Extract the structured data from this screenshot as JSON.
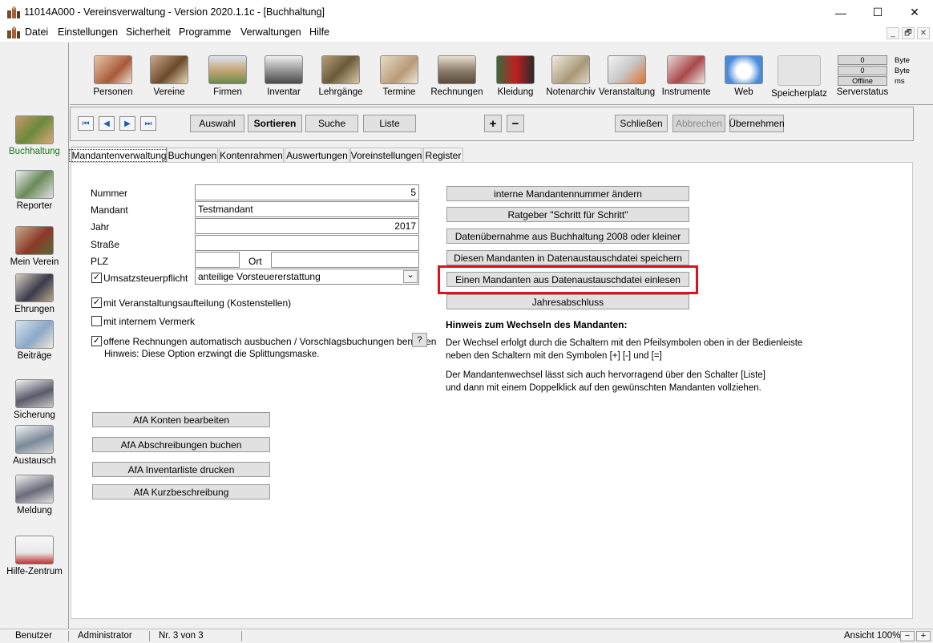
{
  "window": {
    "title": "11014A000 - Vereinsverwaltung - Version 2020.1.1c - [Buchhaltung]",
    "controls": {
      "minimize": "—",
      "maximize": "☐",
      "close": "✕"
    }
  },
  "menu": {
    "items": [
      "Datei",
      "Einstellungen",
      "Sicherheit",
      "Programme",
      "Verwaltungen",
      "Hilfe"
    ],
    "mdi": {
      "minimize": "_",
      "restore": "🗗",
      "close": "✕"
    }
  },
  "toolbar": {
    "logo": "cm",
    "tools": [
      "Personen",
      "Vereine",
      "Firmen",
      "Inventar",
      "Lehrgänge",
      "Termine",
      "Rechnungen",
      "Kleidung",
      "Notenarchiv",
      "Veranstaltung",
      "Instrumente",
      "Web",
      "Speicherplatz",
      "Serverstatus"
    ],
    "status": {
      "values": [
        "0",
        "0",
        "Offline"
      ],
      "units": [
        "Byte",
        "Byte",
        "ms"
      ]
    }
  },
  "sidebar": {
    "items": [
      "Buchhaltung",
      "Reporter",
      "Mein Verein",
      "Ehrungen",
      "Beiträge",
      "Sicherung",
      "Austausch",
      "Meldung",
      "Hilfe-Zentrum"
    ],
    "active_color": "#1a7a1a"
  },
  "navbar": {
    "arrows": {
      "first": "⏮",
      "prev": "◀",
      "next": "▶",
      "last": "⏭"
    },
    "buttons": {
      "auswahl": "Auswahl",
      "sortieren": "Sortieren",
      "suche": "Suche",
      "liste": "Liste",
      "plus": "+",
      "minus": "−",
      "schliessen": "Schließen",
      "abbrechen": "Abbrechen",
      "uebernehmen": "Übernehmen"
    }
  },
  "tabs": [
    "Mandantenverwaltung",
    "Buchungen",
    "Kontenrahmen",
    "Auswertungen",
    "Voreinstellungen",
    "Register"
  ],
  "form": {
    "nummer_label": "Nummer",
    "nummer_value": "5",
    "mandant_label": "Mandant",
    "mandant_value": "Testmandant",
    "jahr_label": "Jahr",
    "jahr_value": "2017",
    "strasse_label": "Straße",
    "strasse_value": "",
    "plz_label": "PLZ",
    "plz_value": "",
    "ort_label": "Ort",
    "ort_value": "",
    "ust_label": "Umsatzsteuerpflicht",
    "ust_checked": "✓",
    "ust_select": "anteilige Vorsteuererstattung",
    "select_arrow": "⌄",
    "veranstaltung_label": "mit Veranstaltungsaufteilung (Kostenstellen)",
    "veranstaltung_checked": "✓",
    "vermerk_label": "mit internem Vermerk",
    "vermerk_checked": "",
    "rechnungen_label": "offene Rechnungen automatisch ausbuchen / Vorschlagsbuchungen benutzen",
    "rechnungen_checked": "✓",
    "help_button": "?",
    "hinweis_text": "Hinweis: Diese Option erzwingt die Splittungsmaske."
  },
  "afa_buttons": [
    "AfA Konten bearbeiten",
    "AfA Abschreibungen buchen",
    "AfA Inventarliste drucken",
    "AfA Kurzbeschreibung"
  ],
  "right_buttons": [
    "interne Mandantennummer ändern",
    "Ratgeber \"Schritt für Schritt\"",
    "Datenübernahme aus Buchhaltung 2008 oder kleiner",
    "Diesen Mandanten in Datenaustauschdatei speichern",
    "Einen Mandanten aus Datenaustauschdatei  einlesen",
    "Jahresabschluss"
  ],
  "hint": {
    "title": "Hinweis zum Wechseln des Mandanten:",
    "p1_line1": "Der Wechsel erfolgt durch die Schaltern mit den Pfeilsymbolen oben in der Bedienleiste",
    "p1_line2": "neben den Schaltern mit den Symbolen [+] [-] und [=]",
    "p2_line1": "Der Mandantenwechsel lässt sich auch hervorragend über den Schalter [Liste]",
    "p2_line2": "und dann mit einem Doppelklick auf den gewünschten Mandanten vollziehen."
  },
  "statusbar": {
    "user_label": "Benutzer",
    "user_value": "Administrator",
    "record": "Nr. 3 von 3",
    "zoom": "Ansicht 100%",
    "zoom_minus": "−",
    "zoom_plus": "+"
  },
  "colors": {
    "highlight": "#e01020",
    "arrow_blue": "#1a5ab8"
  }
}
